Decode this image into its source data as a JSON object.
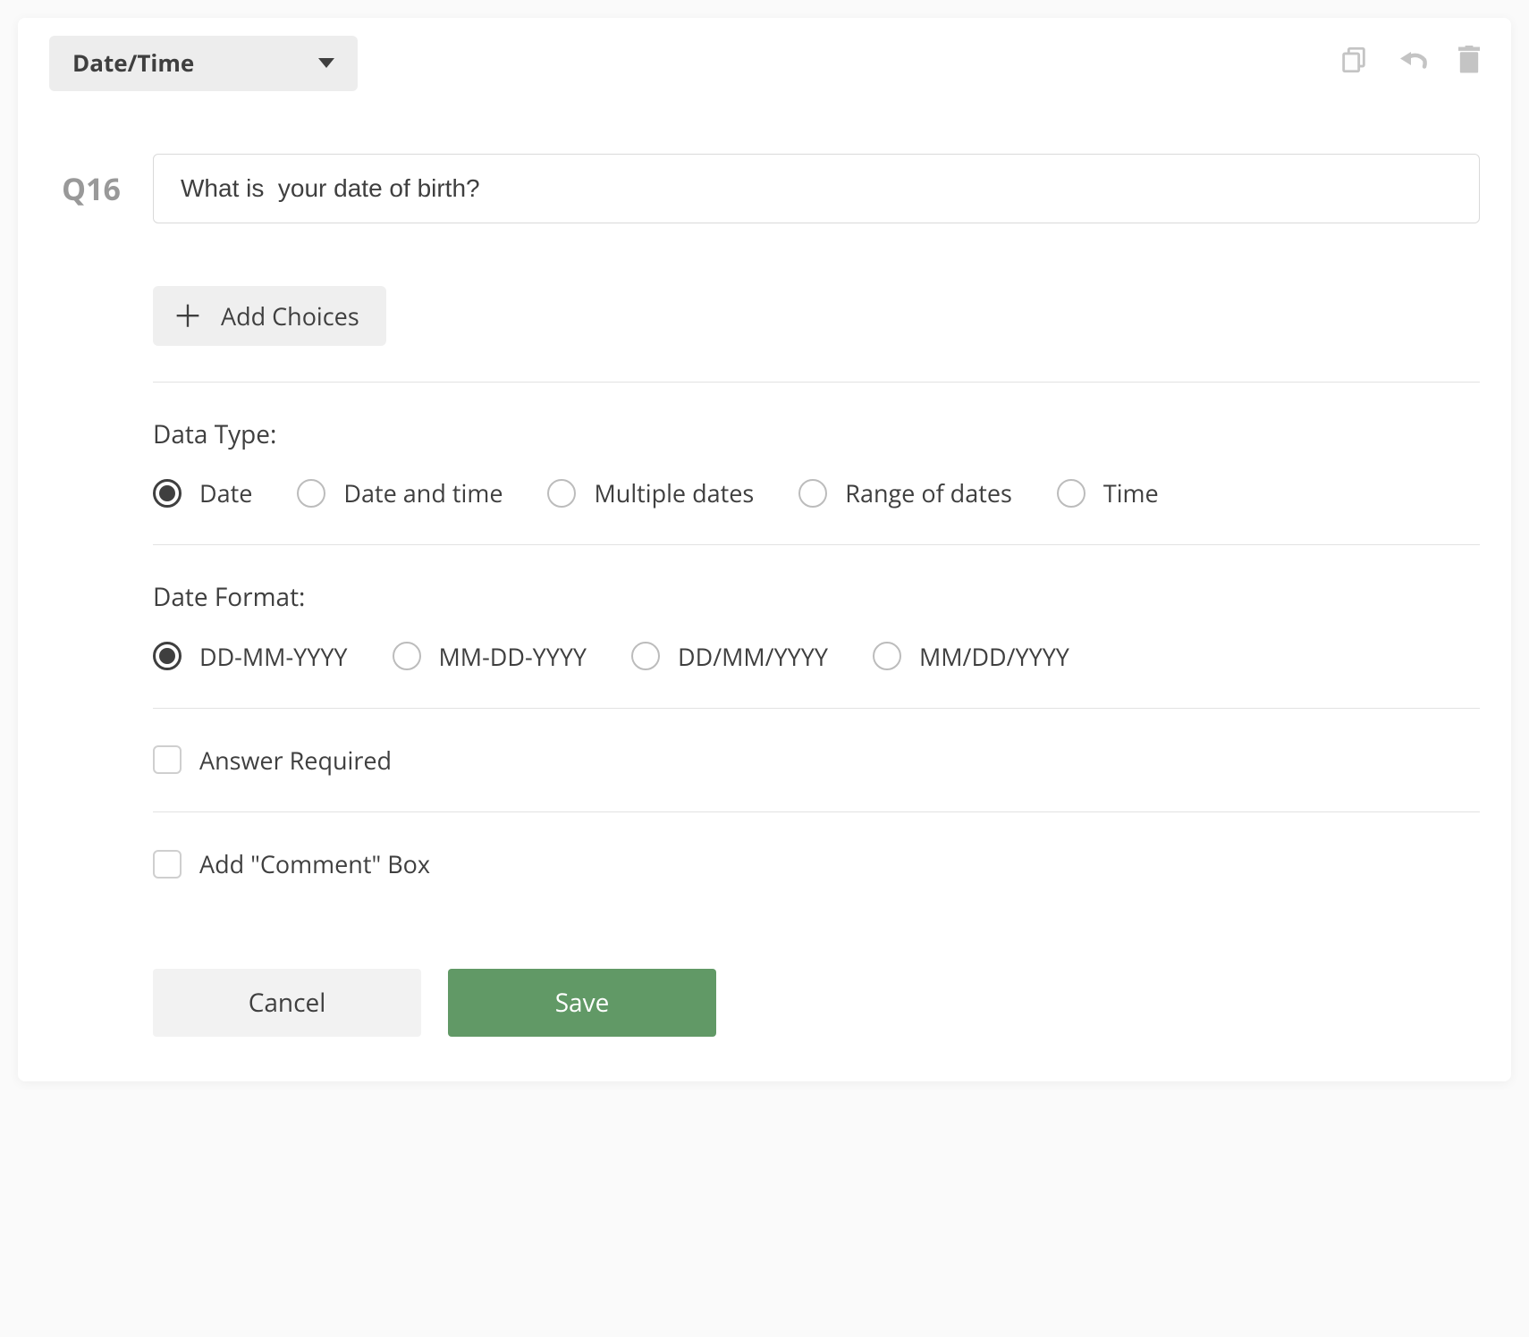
{
  "header": {
    "type_label": "Date/Time"
  },
  "question": {
    "number": "Q16",
    "text": "What is  your date of birth?"
  },
  "add_choices_label": "Add Choices",
  "data_type": {
    "label": "Data Type:",
    "options": [
      {
        "label": "Date",
        "selected": true
      },
      {
        "label": "Date and time",
        "selected": false
      },
      {
        "label": "Multiple dates",
        "selected": false
      },
      {
        "label": "Range of dates",
        "selected": false
      },
      {
        "label": "Time",
        "selected": false
      }
    ]
  },
  "date_format": {
    "label": "Date Format:",
    "options": [
      {
        "label": "DD-MM-YYYY",
        "selected": true
      },
      {
        "label": "MM-DD-YYYY",
        "selected": false
      },
      {
        "label": "DD/MM/YYYY",
        "selected": false
      },
      {
        "label": "MM/DD/YYYY",
        "selected": false
      }
    ]
  },
  "answer_required": {
    "label": "Answer Required",
    "checked": false
  },
  "add_comment": {
    "label": "Add \"Comment\" Box",
    "checked": false
  },
  "buttons": {
    "cancel": "Cancel",
    "save": "Save"
  }
}
